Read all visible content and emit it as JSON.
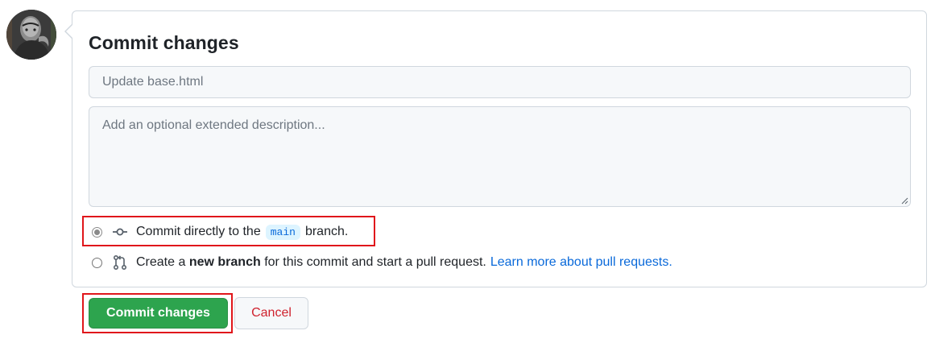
{
  "user": {
    "avatar_icon": "user-avatar"
  },
  "commit_form": {
    "title": "Commit changes",
    "summary": {
      "value": "",
      "placeholder": "Update base.html"
    },
    "description": {
      "value": "",
      "placeholder": "Add an optional extended description..."
    },
    "options": [
      {
        "icon": "git-commit-icon",
        "selected": true,
        "text_before": "Commit directly to the",
        "branch": "main",
        "text_after": "branch."
      },
      {
        "icon": "git-pull-request-icon",
        "selected": false,
        "text_prefix": "Create a",
        "text_bold": "new branch",
        "text_suffix": "for this commit and start a pull request.",
        "link": "Learn more about pull requests."
      }
    ]
  },
  "actions": {
    "commit_label": "Commit changes",
    "cancel_label": "Cancel"
  },
  "colors": {
    "primary_button": "#2da44e",
    "danger_text": "#cf222e",
    "link": "#0969da",
    "highlight": "#e0161b"
  }
}
